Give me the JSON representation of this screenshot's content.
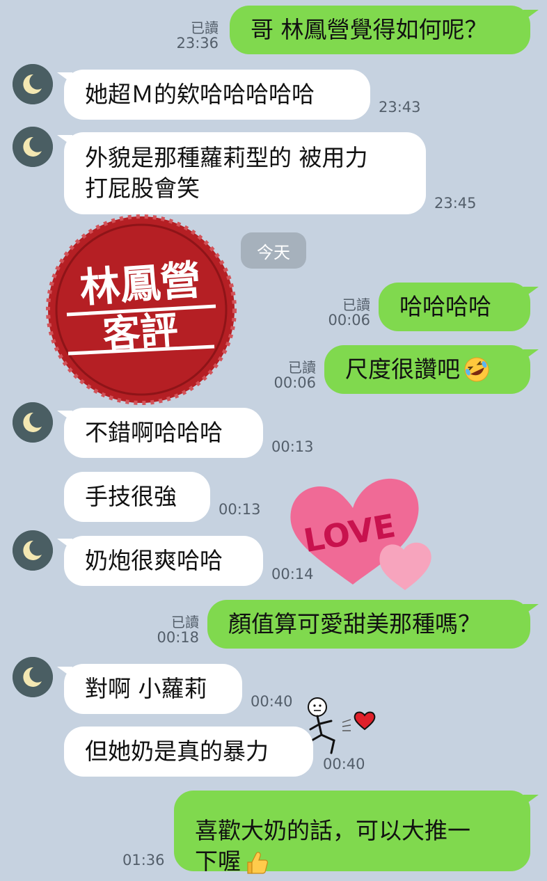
{
  "colors": {
    "background": "#c6d2e0",
    "outgoing_bubble": "#80d94e",
    "incoming_bubble": "#ffffff",
    "avatar": "#4a5e63",
    "stamp_red": "#b51f24"
  },
  "date_divider": "今天",
  "stamp": {
    "line1": "林鳳營",
    "line2": "客評"
  },
  "love_sticker": {
    "text": "LOVE"
  },
  "messages": [
    {
      "direction": "out",
      "text": "哥 林鳳營覺得如何呢？",
      "read": "已讀",
      "time": "23:36"
    },
    {
      "direction": "in",
      "text": "她超Ｍ的欸哈哈哈哈哈",
      "time": "23:43"
    },
    {
      "direction": "in",
      "text": "外貌是那種蘿莉型的 被用力\n打屁股會笑",
      "time": "23:45"
    },
    {
      "direction": "out",
      "text": "哈哈哈哈",
      "read": "已讀",
      "time": "00:06"
    },
    {
      "direction": "out",
      "text": "尺度很讚吧",
      "emoji": "rofl-emoji",
      "read": "已讀",
      "time": "00:06"
    },
    {
      "direction": "in",
      "text": "不錯啊哈哈哈",
      "time": "00:13"
    },
    {
      "direction": "in",
      "text": "手技很強",
      "time": "00:13"
    },
    {
      "direction": "in",
      "text": "奶炮很爽哈哈",
      "time": "00:14"
    },
    {
      "direction": "out",
      "text": "顏值算可愛甜美那種嗎？",
      "read": "已讀",
      "time": "00:18"
    },
    {
      "direction": "in",
      "text": "對啊 小蘿莉",
      "time": "00:40"
    },
    {
      "direction": "in",
      "text": "但她奶是真的暴力",
      "time": "00:40"
    },
    {
      "direction": "out",
      "text": "喜歡大奶的話，可以大推一\n下喔",
      "emoji": "thumbs-up-emoji",
      "time": "01:36"
    }
  ]
}
